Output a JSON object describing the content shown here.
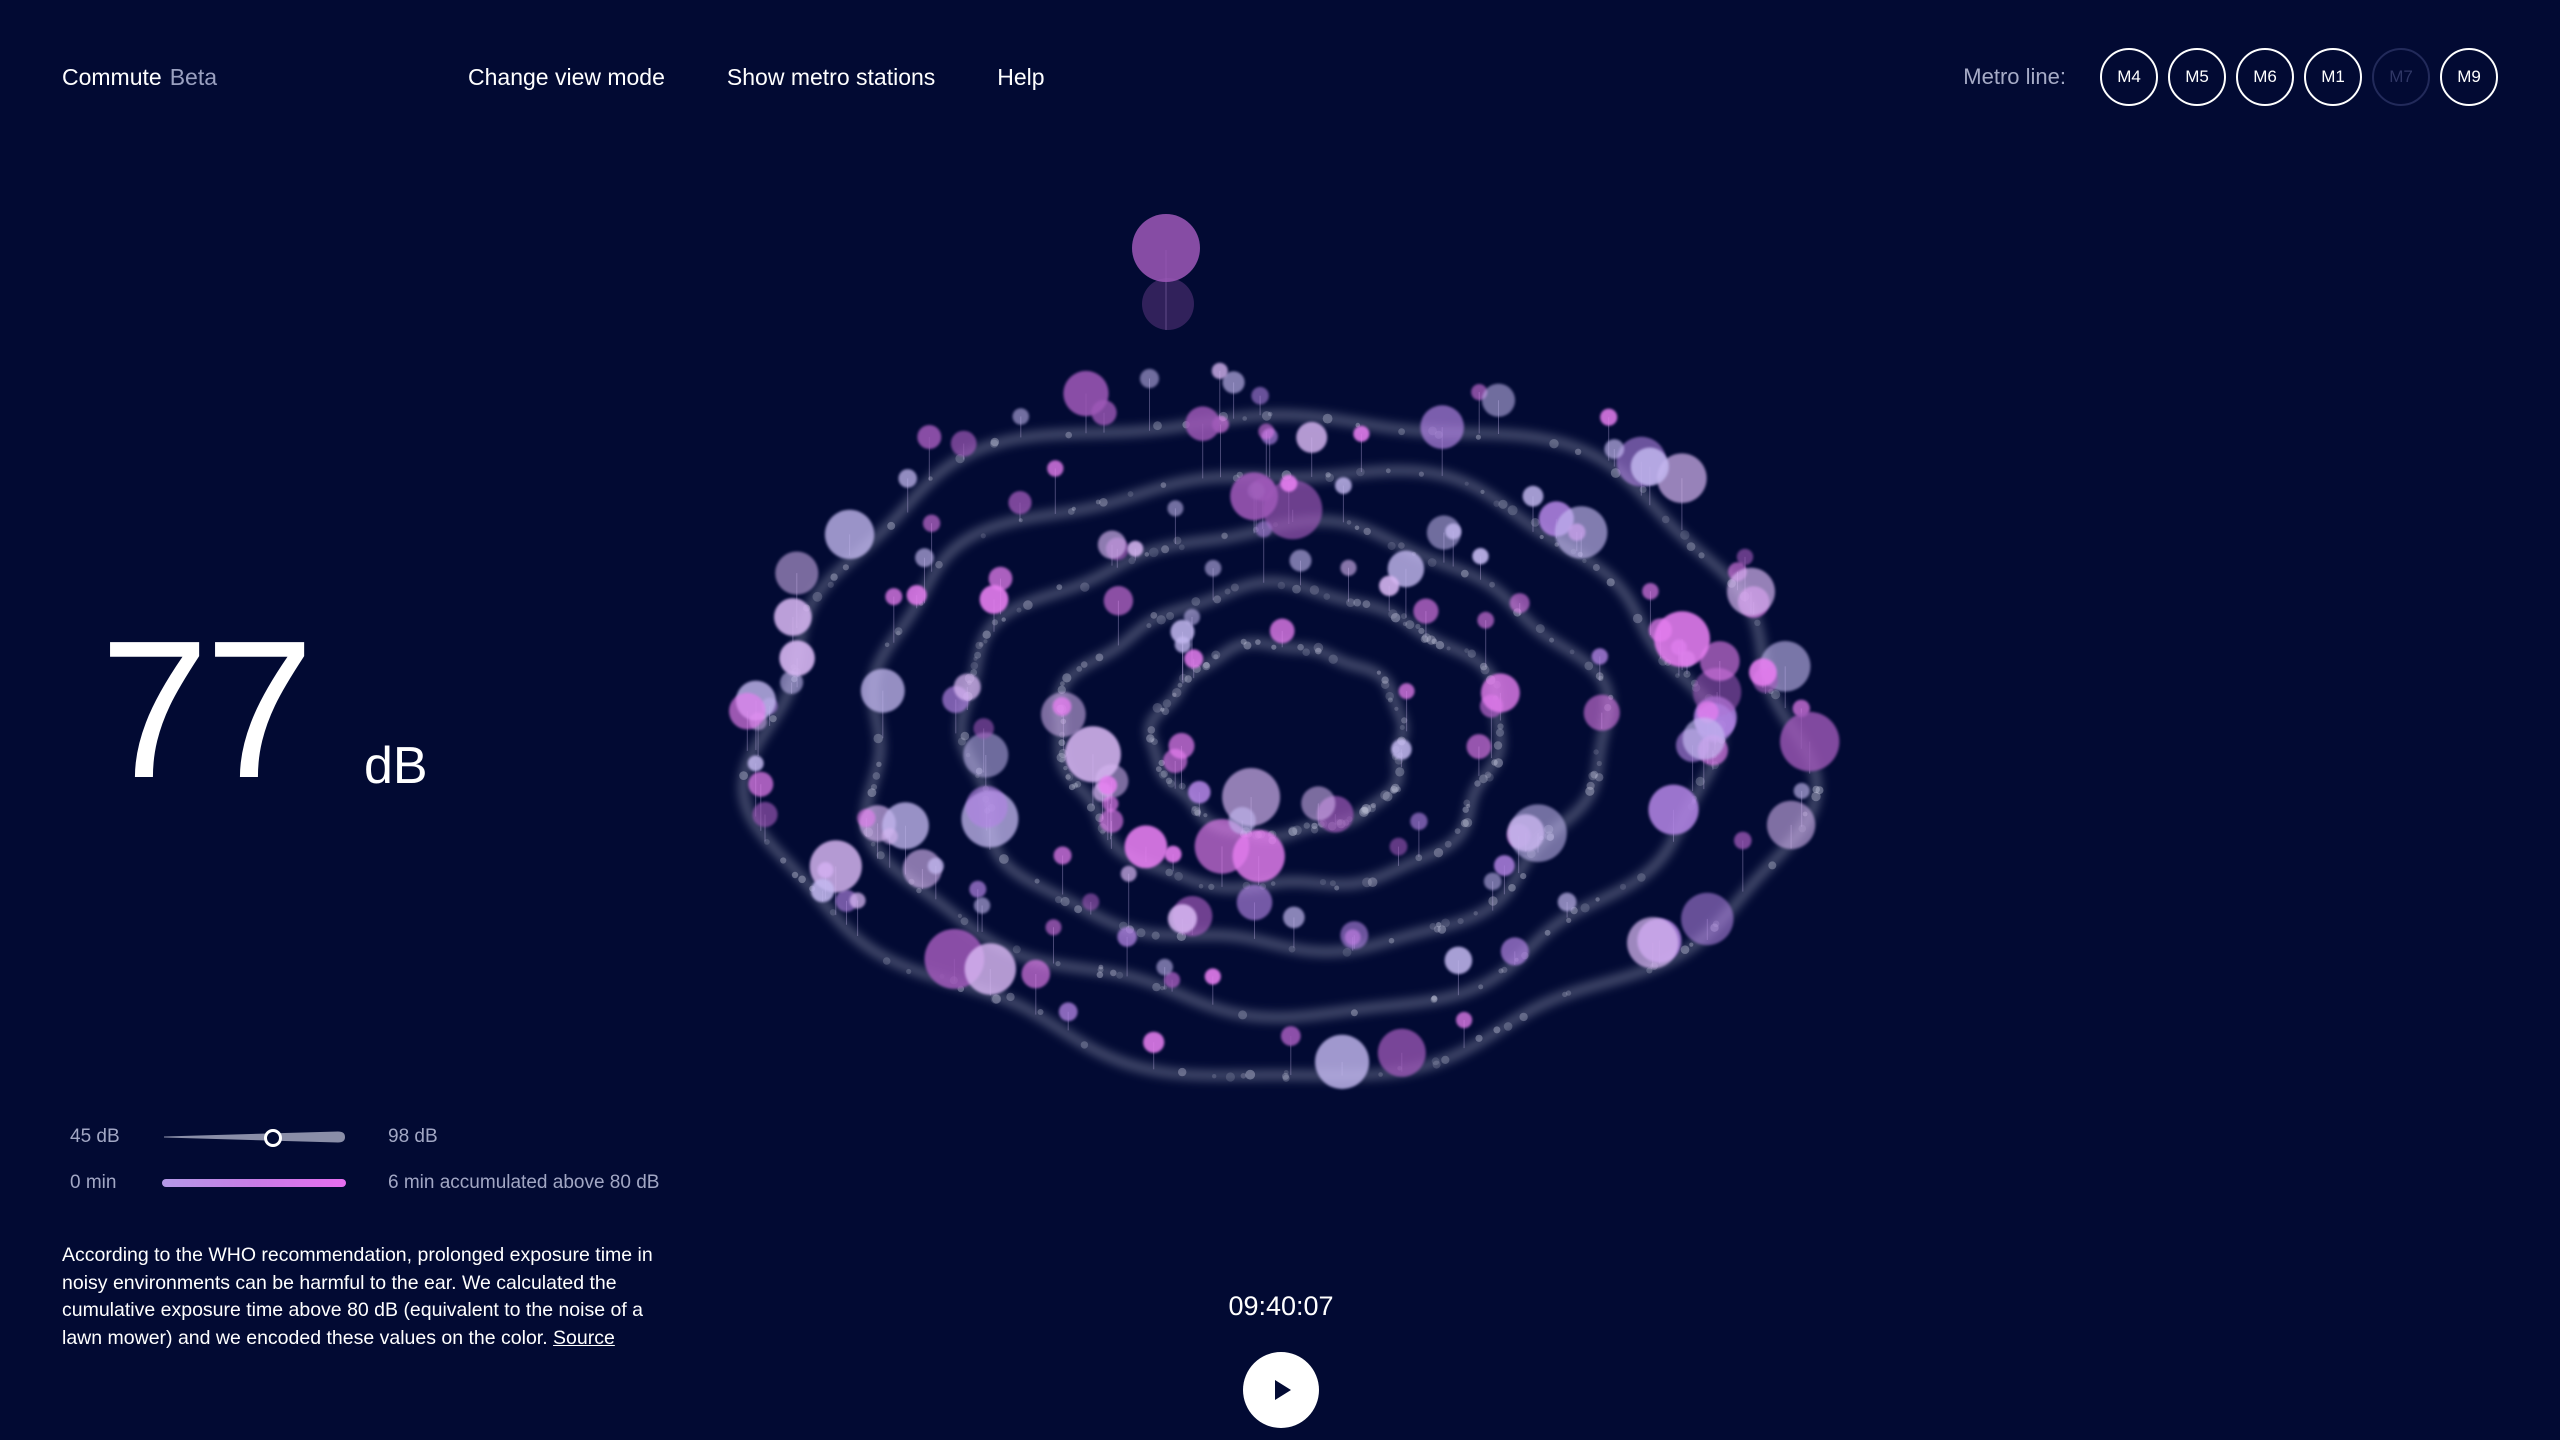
{
  "header": {
    "title": "Commute",
    "badge": "Beta",
    "nav": [
      "Change view mode",
      "Show metro stations",
      "Help"
    ],
    "metro_label": "Metro line:",
    "metro_lines": [
      {
        "label": "M4",
        "active": true
      },
      {
        "label": "M5",
        "active": true
      },
      {
        "label": "M6",
        "active": true
      },
      {
        "label": "M1",
        "active": true
      },
      {
        "label": "M7",
        "active": false
      },
      {
        "label": "M9",
        "active": true
      }
    ]
  },
  "readout": {
    "value": "77",
    "unit": "dB"
  },
  "legend": {
    "range_min": "45 dB",
    "range_max": "98 dB",
    "current_db": 77,
    "time_min": "0 min",
    "time_text": "6 min accumulated above 80 dB"
  },
  "info": {
    "text": "According to the WHO recommendation, prolonged exposure time in noisy environments can be harmful to the ear. We calculated the cumulative exposure time above 80 dB (equivalent to the noise of a lawn mower) and we encoded these values on the color.",
    "link": "Source"
  },
  "playback": {
    "time": "09:40:07"
  },
  "colors": {
    "background": "#020a33",
    "foreground": "#ffffff",
    "muted": "#a2a7c4",
    "lavender": "#c3b8f0",
    "violet": "#b284e4",
    "magenta": "#e67ef0",
    "plum": "#9e58b8",
    "trail": "#aeb2c8",
    "inactive_line": "#222a5a"
  },
  "icons": {
    "play": "play-icon"
  }
}
